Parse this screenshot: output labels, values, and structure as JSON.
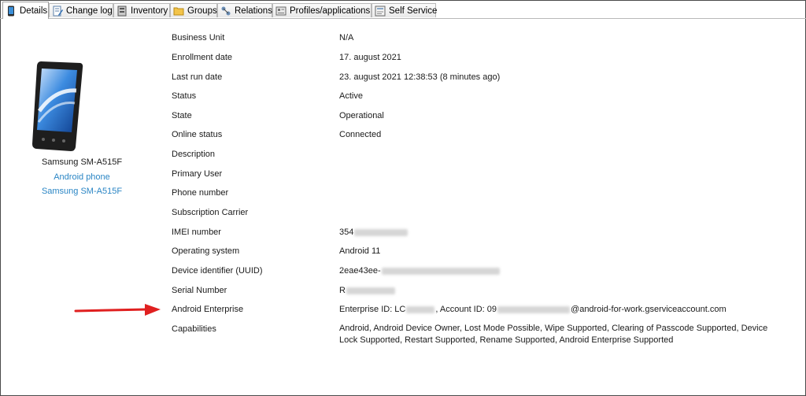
{
  "tabs": [
    {
      "label": "Details",
      "icon": "phone-icon",
      "active": true
    },
    {
      "label": "Change log",
      "icon": "document-edit-icon",
      "active": false
    },
    {
      "label": "Inventory",
      "icon": "inventory-icon",
      "active": false
    },
    {
      "label": "Groups",
      "icon": "folder-icon",
      "active": false
    },
    {
      "label": "Relations",
      "icon": "relations-icon",
      "active": false
    },
    {
      "label": "Profiles/applications",
      "icon": "profiles-icon",
      "active": false
    },
    {
      "label": "Self Service",
      "icon": "self-service-icon",
      "active": false
    }
  ],
  "device": {
    "name": "Samsung SM-A515F",
    "type": "Android phone",
    "model": "Samsung SM-A515F"
  },
  "properties": [
    {
      "label": "Business Unit",
      "value": "N/A"
    },
    {
      "label": "Enrollment date",
      "value": "17. august 2021"
    },
    {
      "label": "Last run date",
      "value": "23. august 2021 12:38:53 (8 minutes ago)"
    },
    {
      "label": "Status",
      "value": "Active"
    },
    {
      "label": "State",
      "value": "Operational"
    },
    {
      "label": "Online status",
      "value": "Connected"
    },
    {
      "label": "Description",
      "value": ""
    },
    {
      "label": "Primary User",
      "value": ""
    },
    {
      "label": "Phone number",
      "value": ""
    },
    {
      "label": "Subscription Carrier",
      "value": ""
    },
    {
      "label": "IMEI number",
      "value": "354"
    },
    {
      "label": "Operating system",
      "value": "Android 11"
    },
    {
      "label": "Device identifier (UUID)",
      "value": "2eae43ee-"
    },
    {
      "label": "Serial Number",
      "value": "R"
    },
    {
      "label": "Android Enterprise",
      "value_prefix": "Enterprise ID: LC",
      "value_mid": ", Account ID: 09",
      "value_suffix": "@android-for-work.gserviceaccount.com"
    },
    {
      "label": "Capabilities",
      "value": "Android, Android Device Owner, Lost Mode Possible, Wipe Supported, Clearing of Passcode Supported, Device Lock Supported, Restart Supported, Rename Supported, Android Enterprise Supported"
    }
  ],
  "colors": {
    "link": "#2b86c5",
    "arrow": "#e02020"
  }
}
